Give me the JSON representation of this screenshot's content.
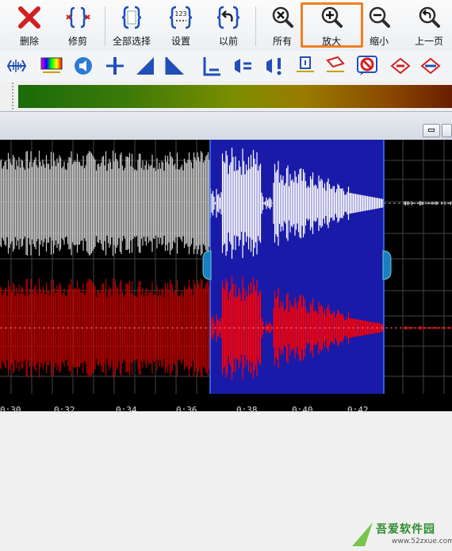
{
  "toolbar": {
    "delete_label": "删除",
    "trim_label": "修剪",
    "select_all_label": "全部选择",
    "set_label": "设置",
    "previous_label": "以前",
    "all_label": "所有",
    "zoom_in_label": "放大",
    "zoom_out_label": "缩小",
    "prev_page_label": "上一页",
    "set_icon_text": "123",
    "active_button": "zoom_in"
  },
  "colors": {
    "highlight": "#f08020",
    "selection": "#1a1aa8",
    "channel_top": "#c8c8c8",
    "channel_top_selected": "#ffffff",
    "channel_bottom": "#b40000",
    "channel_bottom_selected": "#ff0000"
  },
  "timeline": {
    "labels": [
      "0:30",
      "0:32",
      "0:34",
      "0:36",
      "0:38",
      "0:40",
      "0:42"
    ]
  },
  "watermark": {
    "title": "吾爱软件园",
    "url": "www.52zxue.com"
  }
}
